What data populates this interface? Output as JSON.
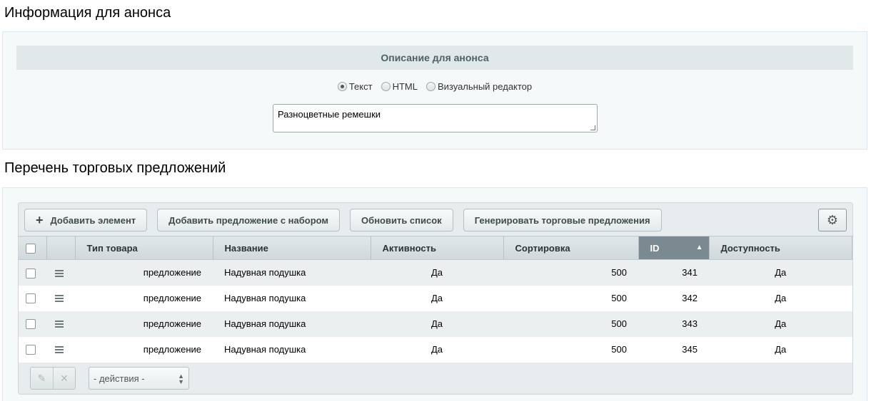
{
  "announce": {
    "section_title": "Информация для анонса",
    "description_header": "Описание для анонса",
    "radio_options": [
      "Текст",
      "HTML",
      "Визуальный редактор"
    ],
    "selected_radio": "Текст",
    "textarea_value": "Разноцветные ремешки"
  },
  "offers": {
    "section_title": "Перечень торговых предложений",
    "toolbar": {
      "add_element": "Добавить элемент",
      "add_set_offer": "Добавить предложение с набором",
      "refresh_list": "Обновить список",
      "generate_offers": "Генерировать торговые предложения"
    },
    "columns": [
      "Тип товара",
      "Название",
      "Активность",
      "Сортировка",
      "ID",
      "Доступность"
    ],
    "sorted_column": "ID",
    "rows": [
      {
        "type": "предложение",
        "name": "Надувная подушка",
        "active": "Да",
        "sort": "500",
        "id": "341",
        "available": "Да"
      },
      {
        "type": "предложение",
        "name": "Надувная подушка",
        "active": "Да",
        "sort": "500",
        "id": "342",
        "available": "Да"
      },
      {
        "type": "предложение",
        "name": "Надувная подушка",
        "active": "Да",
        "sort": "500",
        "id": "343",
        "available": "Да"
      },
      {
        "type": "предложение",
        "name": "Надувная подушка",
        "active": "Да",
        "sort": "500",
        "id": "345",
        "available": "Да"
      }
    ],
    "actions_select": "- действия -"
  },
  "colors": {
    "sorted_header": "#7a8a90",
    "panel_bg": "#f5f9f9",
    "odd_row": "#ebeff0"
  }
}
